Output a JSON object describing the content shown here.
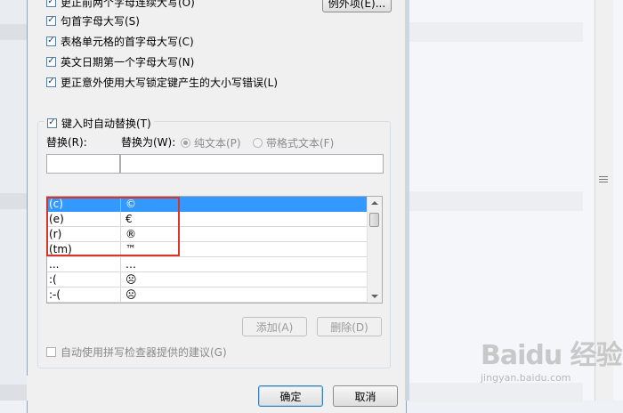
{
  "options": [
    {
      "label": "更正前两个字母连续大写(O)",
      "checked": true
    },
    {
      "label": "句首字母大写(S)",
      "checked": true
    },
    {
      "label": "表格单元格的首字母大写(C)",
      "checked": true
    },
    {
      "label": "英文日期第一个字母大写(N)",
      "checked": true
    },
    {
      "label": "更正意外使用大写锁定键产生的大小写错误(L)",
      "checked": true
    }
  ],
  "exceptions_button": "例外项(E)...",
  "autoreplace": {
    "label": "键入时自动替换(T)",
    "checked": true,
    "replace_label": "替换(R):",
    "with_label": "替换为(W):",
    "plain_text": "纯文本(P)",
    "formatted_text": "带格式文本(F)",
    "replace_value": "",
    "with_value": ""
  },
  "entries": [
    {
      "from": "(c)",
      "to": "©",
      "selected": true
    },
    {
      "from": "(e)",
      "to": "€",
      "selected": false
    },
    {
      "from": "(r)",
      "to": "®",
      "selected": false
    },
    {
      "from": "(tm)",
      "to": "™",
      "selected": false
    },
    {
      "from": "...",
      "to": "…",
      "selected": false
    },
    {
      "from": ":(",
      "to": "☹",
      "selected": false
    },
    {
      "from": ":-(",
      "to": "☹",
      "selected": false
    }
  ],
  "add_button": "添加(A)",
  "delete_button": "删除(D)",
  "spellcheck": {
    "label": "自动使用拼写检查器提供的建议(G)",
    "checked": false
  },
  "ok_button": "确定",
  "cancel_button": "取消",
  "watermark": {
    "logo": "Baidu 经验",
    "url": "jingyan.baidu.com"
  },
  "colors": {
    "selection": "#3399ff",
    "highlight": "#d9342b"
  }
}
